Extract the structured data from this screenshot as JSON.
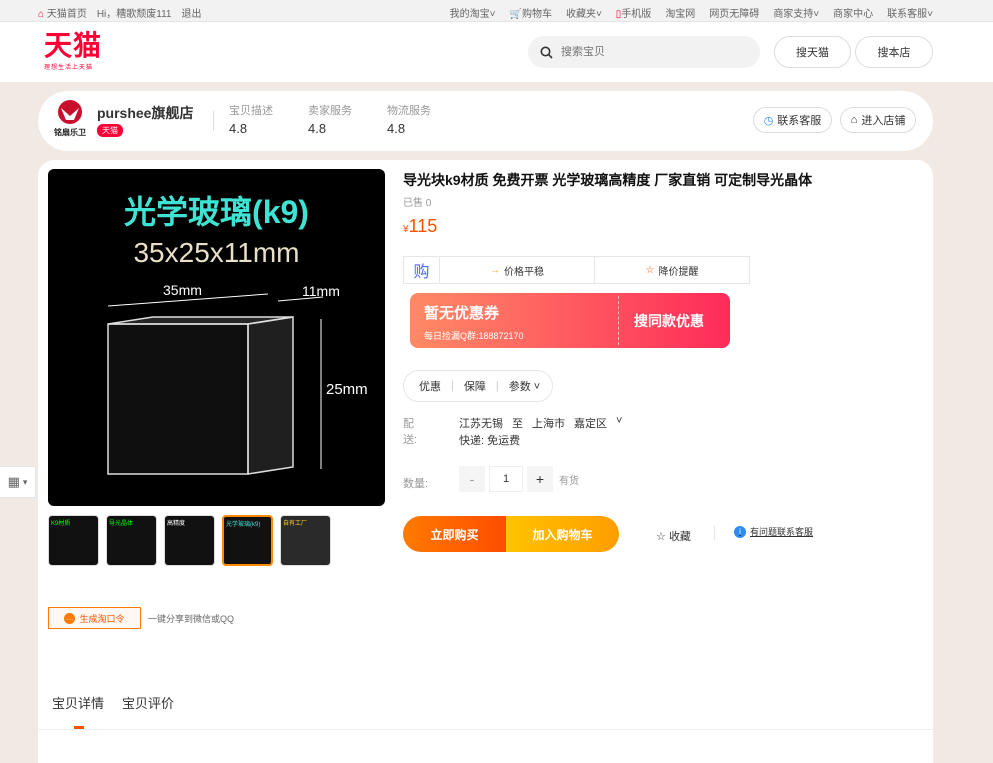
{
  "topbar": {
    "home": "天猫首页",
    "greeting": "Hi，糟歌颓废111",
    "logout": "退出",
    "my_taobao": "我的淘宝",
    "cart": "购物车",
    "favorites": "收藏夹",
    "mobile": "手机版",
    "taobao": "淘宝网",
    "barrier_free": "网页无障碍",
    "merchant_support": "商家支持",
    "merchant_center": "商家中心",
    "contact": "联系客服"
  },
  "header": {
    "logo_text": "天猫",
    "logo_slogan": "理想生活上天猫",
    "search_placeholder": "搜索宝贝",
    "search_tmall": "搜天猫",
    "search_store": "搜本店"
  },
  "shop": {
    "name": "purshee旗舰店",
    "badge": "天猫",
    "logo_text": "铭扇乐卫",
    "ratings": [
      {
        "label": "宝贝描述",
        "value": "4.8"
      },
      {
        "label": "卖家服务",
        "value": "4.8"
      },
      {
        "label": "物流服务",
        "value": "4.8"
      }
    ],
    "contact_btn": "联系客服",
    "enter_btn": "进入店铺"
  },
  "product": {
    "title": "导光块k9材质 免费开票 光学玻璃高精度 厂家直销 可定制导光晶体",
    "sold": "已售 0",
    "currency": "¥",
    "price": "115",
    "buy_tag": "购",
    "price_stable": "价格平稳",
    "price_alert": "降价提醒",
    "coupon_title": "暂无优惠券",
    "coupon_sub": "每日捡漏Q群:188872170",
    "coupon_action": "搜同款优惠",
    "tabs": [
      "优惠",
      "保障",
      "参数"
    ],
    "delivery_label": "配送:",
    "ship_from": "江苏无锡",
    "ship_to_word": "至",
    "ship_to_city": "上海市",
    "ship_to_district": "嘉定区",
    "shipping": "快递: 免运费",
    "qty_label": "数量:",
    "qty_minus": "-",
    "qty_value": "1",
    "qty_plus": "+",
    "stock": "有货",
    "buy_now": "立即购买",
    "add_cart": "加入购物车",
    "favorite": "收藏",
    "service_link": "有问题联系客服"
  },
  "images": {
    "main_line1": "光学玻璃(k9)",
    "main_line2": "35x25x11mm",
    "dim_35": "35mm",
    "dim_11": "11mm",
    "dim_25": "25mm",
    "thumbs": [
      "K9材质",
      "导光晶体",
      "高精度",
      "光学玻璃(k9)",
      "自有工厂"
    ]
  },
  "share": {
    "poster_btn": "生成淘口令",
    "tip": "一键分享到微信或QQ"
  },
  "detail": {
    "tab1": "宝贝详情",
    "tab2": "宝贝评价"
  },
  "colors": {
    "brand_red": "#ff0036",
    "price_orange": "#ff5000",
    "buy_orange": "#ff7a00",
    "cart_yellow": "#ffc300"
  }
}
